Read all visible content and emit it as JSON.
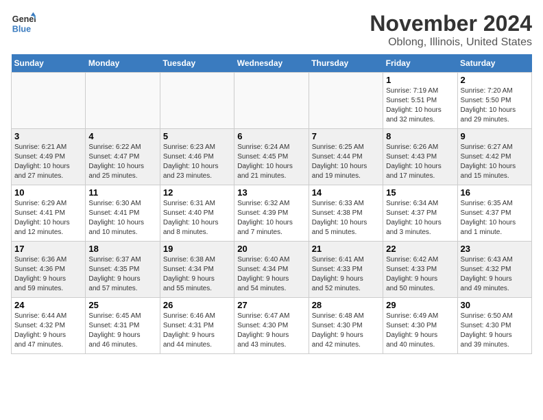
{
  "logo": {
    "line1": "General",
    "line2": "Blue"
  },
  "title": "November 2024",
  "location": "Oblong, Illinois, United States",
  "weekdays": [
    "Sunday",
    "Monday",
    "Tuesday",
    "Wednesday",
    "Thursday",
    "Friday",
    "Saturday"
  ],
  "weeks": [
    [
      {
        "day": "",
        "info": ""
      },
      {
        "day": "",
        "info": ""
      },
      {
        "day": "",
        "info": ""
      },
      {
        "day": "",
        "info": ""
      },
      {
        "day": "",
        "info": ""
      },
      {
        "day": "1",
        "info": "Sunrise: 7:19 AM\nSunset: 5:51 PM\nDaylight: 10 hours\nand 32 minutes."
      },
      {
        "day": "2",
        "info": "Sunrise: 7:20 AM\nSunset: 5:50 PM\nDaylight: 10 hours\nand 29 minutes."
      }
    ],
    [
      {
        "day": "3",
        "info": "Sunrise: 6:21 AM\nSunset: 4:49 PM\nDaylight: 10 hours\nand 27 minutes."
      },
      {
        "day": "4",
        "info": "Sunrise: 6:22 AM\nSunset: 4:47 PM\nDaylight: 10 hours\nand 25 minutes."
      },
      {
        "day": "5",
        "info": "Sunrise: 6:23 AM\nSunset: 4:46 PM\nDaylight: 10 hours\nand 23 minutes."
      },
      {
        "day": "6",
        "info": "Sunrise: 6:24 AM\nSunset: 4:45 PM\nDaylight: 10 hours\nand 21 minutes."
      },
      {
        "day": "7",
        "info": "Sunrise: 6:25 AM\nSunset: 4:44 PM\nDaylight: 10 hours\nand 19 minutes."
      },
      {
        "day": "8",
        "info": "Sunrise: 6:26 AM\nSunset: 4:43 PM\nDaylight: 10 hours\nand 17 minutes."
      },
      {
        "day": "9",
        "info": "Sunrise: 6:27 AM\nSunset: 4:42 PM\nDaylight: 10 hours\nand 15 minutes."
      }
    ],
    [
      {
        "day": "10",
        "info": "Sunrise: 6:29 AM\nSunset: 4:41 PM\nDaylight: 10 hours\nand 12 minutes."
      },
      {
        "day": "11",
        "info": "Sunrise: 6:30 AM\nSunset: 4:41 PM\nDaylight: 10 hours\nand 10 minutes."
      },
      {
        "day": "12",
        "info": "Sunrise: 6:31 AM\nSunset: 4:40 PM\nDaylight: 10 hours\nand 8 minutes."
      },
      {
        "day": "13",
        "info": "Sunrise: 6:32 AM\nSunset: 4:39 PM\nDaylight: 10 hours\nand 7 minutes."
      },
      {
        "day": "14",
        "info": "Sunrise: 6:33 AM\nSunset: 4:38 PM\nDaylight: 10 hours\nand 5 minutes."
      },
      {
        "day": "15",
        "info": "Sunrise: 6:34 AM\nSunset: 4:37 PM\nDaylight: 10 hours\nand 3 minutes."
      },
      {
        "day": "16",
        "info": "Sunrise: 6:35 AM\nSunset: 4:37 PM\nDaylight: 10 hours\nand 1 minute."
      }
    ],
    [
      {
        "day": "17",
        "info": "Sunrise: 6:36 AM\nSunset: 4:36 PM\nDaylight: 9 hours\nand 59 minutes."
      },
      {
        "day": "18",
        "info": "Sunrise: 6:37 AM\nSunset: 4:35 PM\nDaylight: 9 hours\nand 57 minutes."
      },
      {
        "day": "19",
        "info": "Sunrise: 6:38 AM\nSunset: 4:34 PM\nDaylight: 9 hours\nand 55 minutes."
      },
      {
        "day": "20",
        "info": "Sunrise: 6:40 AM\nSunset: 4:34 PM\nDaylight: 9 hours\nand 54 minutes."
      },
      {
        "day": "21",
        "info": "Sunrise: 6:41 AM\nSunset: 4:33 PM\nDaylight: 9 hours\nand 52 minutes."
      },
      {
        "day": "22",
        "info": "Sunrise: 6:42 AM\nSunset: 4:33 PM\nDaylight: 9 hours\nand 50 minutes."
      },
      {
        "day": "23",
        "info": "Sunrise: 6:43 AM\nSunset: 4:32 PM\nDaylight: 9 hours\nand 49 minutes."
      }
    ],
    [
      {
        "day": "24",
        "info": "Sunrise: 6:44 AM\nSunset: 4:32 PM\nDaylight: 9 hours\nand 47 minutes."
      },
      {
        "day": "25",
        "info": "Sunrise: 6:45 AM\nSunset: 4:31 PM\nDaylight: 9 hours\nand 46 minutes."
      },
      {
        "day": "26",
        "info": "Sunrise: 6:46 AM\nSunset: 4:31 PM\nDaylight: 9 hours\nand 44 minutes."
      },
      {
        "day": "27",
        "info": "Sunrise: 6:47 AM\nSunset: 4:30 PM\nDaylight: 9 hours\nand 43 minutes."
      },
      {
        "day": "28",
        "info": "Sunrise: 6:48 AM\nSunset: 4:30 PM\nDaylight: 9 hours\nand 42 minutes."
      },
      {
        "day": "29",
        "info": "Sunrise: 6:49 AM\nSunset: 4:30 PM\nDaylight: 9 hours\nand 40 minutes."
      },
      {
        "day": "30",
        "info": "Sunrise: 6:50 AM\nSunset: 4:30 PM\nDaylight: 9 hours\nand 39 minutes."
      }
    ]
  ]
}
